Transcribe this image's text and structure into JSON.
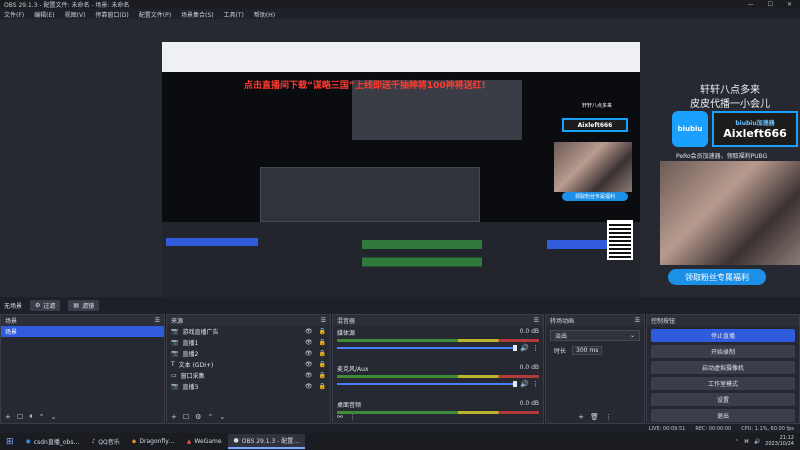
{
  "window": {
    "title": "OBS 29.1.3 - 配置文件: 未命名 - 场景: 未命名"
  },
  "menu": [
    "文件(F)",
    "编辑(E)",
    "视图(V)",
    "停靠窗口(D)",
    "配置文件(P)",
    "场景集合(S)",
    "工具(T)",
    "帮助(H)"
  ],
  "overlay": {
    "banner": "点击直播间下载“谋略三国”上线即送千抽神将100神将送红!",
    "slogan_line1": "轩轩八点多来",
    "slogan_line2": "皮皮代播一小会儿",
    "logo_text": "biubiu",
    "id_label": "biubiu加速器",
    "id_code": "Aixleft666",
    "promo_line": "PeRo会员加速器，领取福利PUBG",
    "fan_button": "领取粉丝专属福利"
  },
  "scene_toolbar": {
    "label": "无场景",
    "buttons": [
      "过滤",
      "滤镜"
    ]
  },
  "docks": {
    "scenes": {
      "title": "场景",
      "items": [
        {
          "label": "场景"
        }
      ]
    },
    "sources": {
      "title": "来源",
      "items": [
        {
          "label": "游戏直播广告"
        },
        {
          "label": "直播1"
        },
        {
          "label": "直播2"
        },
        {
          "label": "文本 (GDI+)"
        },
        {
          "label": "窗口采集"
        },
        {
          "label": "直播3"
        }
      ]
    },
    "mixer": {
      "title": "混音器",
      "channels": [
        {
          "name": "媒体源",
          "db": "0.0 dB"
        },
        {
          "name": "麦克风/Aux",
          "db": "0.0 dB"
        },
        {
          "name": "桌面音频",
          "db": "0.0 dB"
        }
      ]
    },
    "transitions": {
      "title": "转场动画",
      "type": "淡出",
      "duration_label": "时长",
      "duration": "300 ms"
    },
    "controls": {
      "title": "控制按钮",
      "buttons": [
        {
          "label": "停止直播",
          "active": true
        },
        {
          "label": "开始录制",
          "active": false
        },
        {
          "label": "启动虚拟摄像机",
          "active": false
        },
        {
          "label": "工作室模式",
          "active": false
        },
        {
          "label": "设置",
          "active": false
        },
        {
          "label": "退出",
          "active": false
        }
      ]
    }
  },
  "status": {
    "live": "LIVE: 00:09:51",
    "rec": "REC: 00:00:00",
    "cpu": "CPU: 1.1%, 60.00 fps"
  },
  "taskbar": {
    "apps": [
      {
        "label": "csdn直播_obs…"
      },
      {
        "label": "QQ音乐"
      },
      {
        "label": "Dragonfly…"
      },
      {
        "label": "WeGame"
      },
      {
        "label": "OBS 29.1.3 - 配置…"
      }
    ],
    "time": "21:12",
    "date": "2023/10/24"
  }
}
